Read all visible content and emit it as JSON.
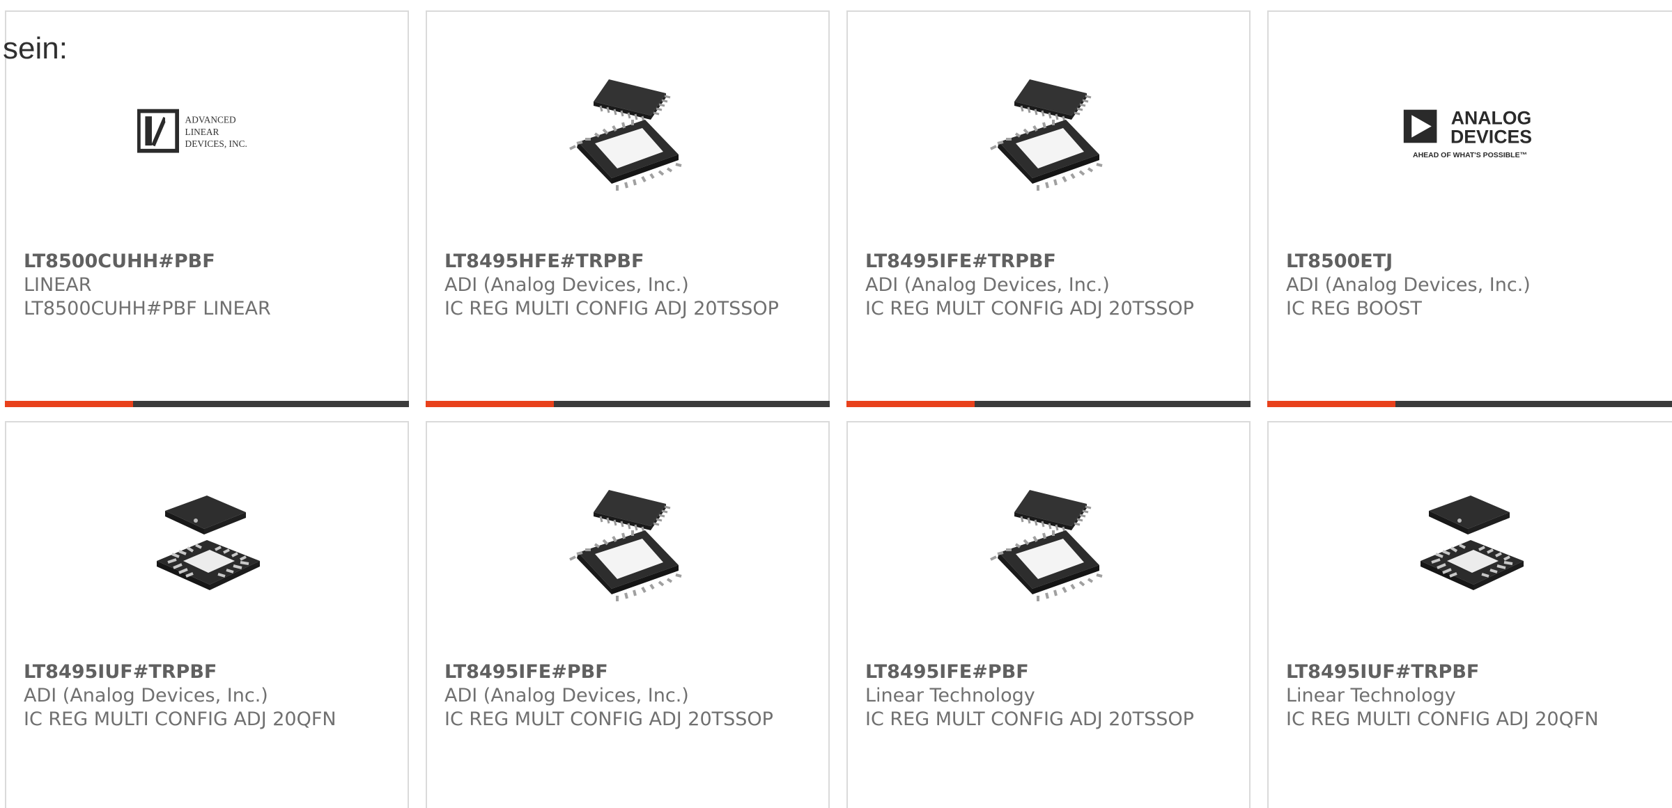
{
  "lead_text": "sein:",
  "colors": {
    "accent": "#e8411c",
    "bar": "#3b3b3b",
    "border": "#dadada",
    "text": "#707070"
  },
  "cards": [
    {
      "part_number": "LT8500CUHH#PBF",
      "manufacturer": "LINEAR",
      "description": "LT8500CUHH#PBF LINEAR",
      "image": "advanced-linear-devices-logo",
      "logo_lines": [
        "ADVANCED",
        "LINEAR",
        "DEVICES, INC."
      ]
    },
    {
      "part_number": "LT8495HFE#TRPBF",
      "manufacturer": "ADI (Analog Devices, Inc.)",
      "description": "IC REG MULTI CONFIG ADJ 20TSSOP",
      "image": "tssop-chip"
    },
    {
      "part_number": "LT8495IFE#TRPBF",
      "manufacturer": "ADI (Analog Devices, Inc.)",
      "description": "IC REG MULT CONFIG ADJ 20TSSOP",
      "image": "tssop-chip"
    },
    {
      "part_number": "LT8500ETJ",
      "manufacturer": "ADI (Analog Devices, Inc.)",
      "description": "IC REG BOOST",
      "image": "analog-devices-logo",
      "logo_lines": [
        "ANALOG",
        "DEVICES",
        "AHEAD OF WHAT'S POSSIBLE™"
      ]
    },
    {
      "part_number": "LT8495IUF#TRPBF",
      "manufacturer": "ADI (Analog Devices, Inc.)",
      "description": "IC REG MULTI CONFIG ADJ 20QFN",
      "image": "qfn-chip"
    },
    {
      "part_number": "LT8495IFE#PBF",
      "manufacturer": "ADI (Analog Devices, Inc.)",
      "description": "IC REG MULT CONFIG ADJ 20TSSOP",
      "image": "tssop-chip"
    },
    {
      "part_number": "LT8495IFE#PBF",
      "manufacturer": "Linear Technology",
      "description": "IC REG MULT CONFIG ADJ 20TSSOP",
      "image": "tssop-chip"
    },
    {
      "part_number": "LT8495IUF#TRPBF",
      "manufacturer": "Linear Technology",
      "description": "IC REG MULTI CONFIG ADJ 20QFN",
      "image": "qfn-chip"
    }
  ]
}
